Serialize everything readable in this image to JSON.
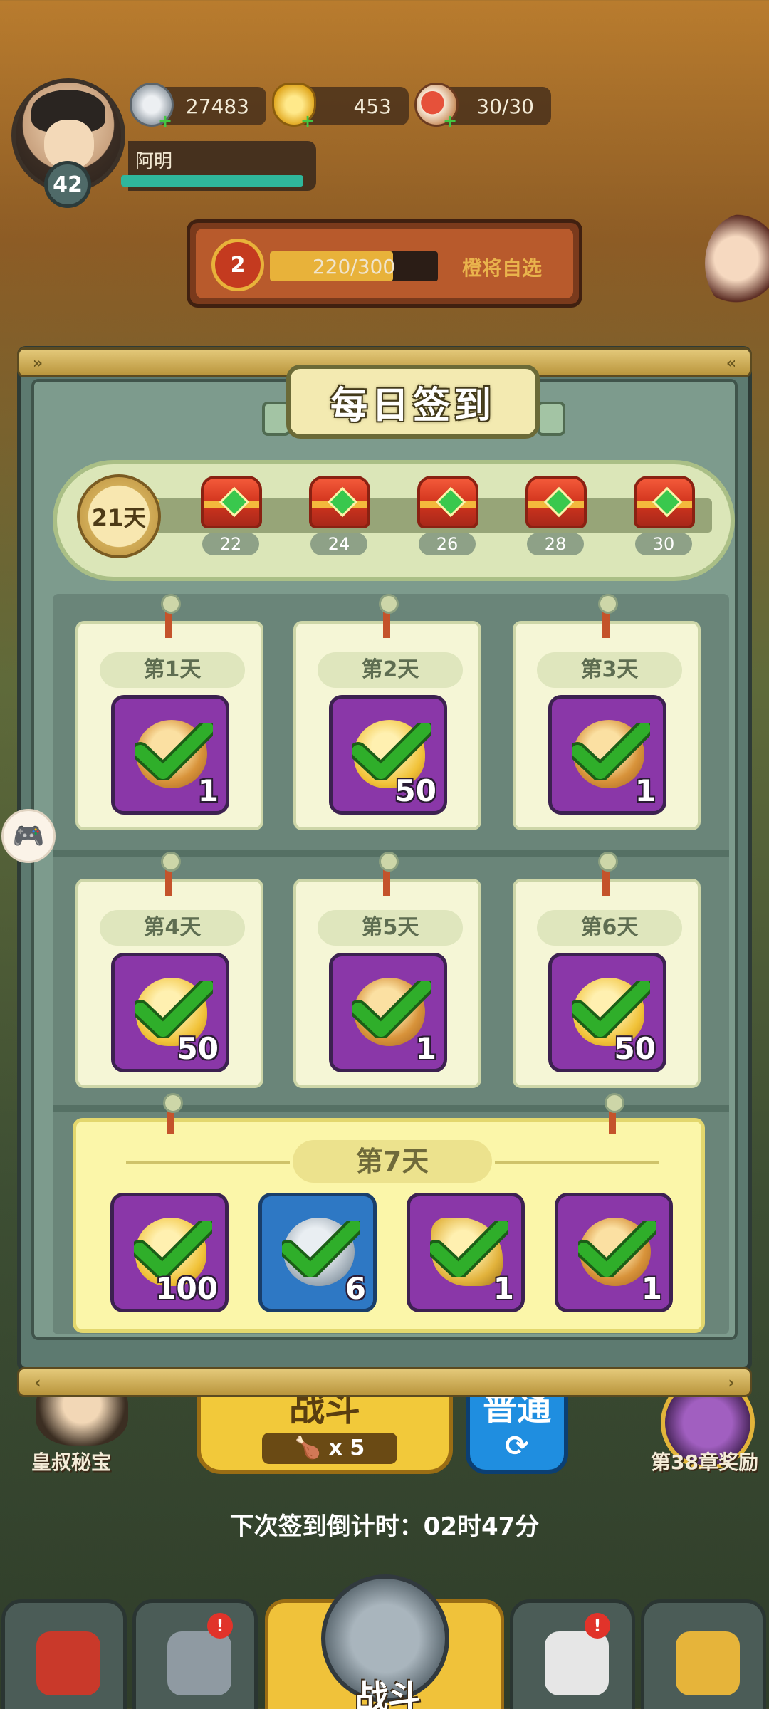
{
  "hud": {
    "player": {
      "name": "阿明",
      "level": "42"
    },
    "resources": {
      "silver": {
        "value": "27483",
        "icon": "silver-coin-icon"
      },
      "gold": {
        "value": "453",
        "icon": "gold-ingot-icon"
      },
      "stamina": {
        "value": "30/30",
        "icon": "meat-drumstick-icon"
      }
    },
    "hero_banner": {
      "rank": "2",
      "progress_text": "220/300",
      "progress_fraction": 0.733,
      "label": "橙将自选"
    }
  },
  "checkin": {
    "title": "每日签到",
    "current_days": "21天",
    "progress_fraction": 0.03,
    "milestones": [
      {
        "day": "22",
        "icon": "red-chest-icon"
      },
      {
        "day": "24",
        "icon": "red-chest-icon"
      },
      {
        "day": "26",
        "icon": "red-chest-icon"
      },
      {
        "day": "28",
        "icon": "red-chest-icon"
      },
      {
        "day": "30",
        "icon": "red-chest-icon"
      }
    ],
    "days": [
      {
        "label": "第1天",
        "reward_icon": "food-bowl-icon",
        "count": "1",
        "claimed": true
      },
      {
        "label": "第2天",
        "reward_icon": "gold-heart-icon",
        "count": "50",
        "claimed": true
      },
      {
        "label": "第3天",
        "reward_icon": "food-bowl-icon",
        "count": "1",
        "claimed": true
      },
      {
        "label": "第4天",
        "reward_icon": "gold-heart-icon",
        "count": "50",
        "claimed": true
      },
      {
        "label": "第5天",
        "reward_icon": "food-bowl-icon",
        "count": "1",
        "claimed": true
      },
      {
        "label": "第6天",
        "reward_icon": "gold-heart-icon",
        "count": "50",
        "claimed": true
      }
    ],
    "day7": {
      "label": "第7天",
      "rewards": [
        {
          "reward_icon": "gold-heart-icon",
          "count": "100",
          "color": "purple",
          "claimed": true
        },
        {
          "reward_icon": "sword-icon",
          "count": "6",
          "color": "blue",
          "claimed": true
        },
        {
          "reward_icon": "flag-icon",
          "count": "1",
          "color": "purple",
          "claimed": true
        },
        {
          "reward_icon": "food-bowl-icon",
          "count": "1",
          "color": "purple",
          "claimed": true
        }
      ]
    },
    "countdown": "下次签到倒计时：02时47分"
  },
  "background": {
    "battle": {
      "label": "战斗",
      "cost": "x 5"
    },
    "mode": {
      "label": "普通",
      "icon": "refresh-icon"
    },
    "left_feature": "皇叔秘宝",
    "right_feature": "第38章奖励"
  },
  "nav": {
    "center_label": "战斗",
    "badge": "!"
  },
  "colors": {
    "claimed_check": "#2fae2a",
    "item_purple": "#8a37a8",
    "item_blue": "#2e78c4",
    "accent_gold": "#f6c844"
  }
}
